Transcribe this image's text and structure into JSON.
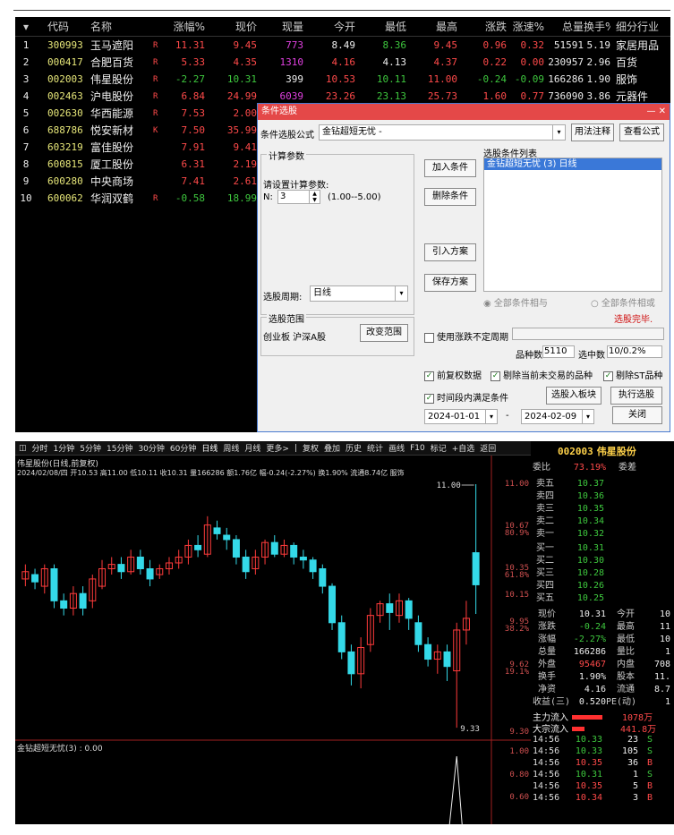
{
  "table": {
    "headers": [
      "代码",
      "名称",
      "",
      "涨幅%",
      "现价",
      "现量",
      "今开",
      "最低",
      "最高",
      "涨跌",
      "涨速%",
      "总量",
      "换手%",
      "细分行业"
    ],
    "rows": [
      {
        "idx": "1",
        "code": "300993",
        "name": "玉马遮阳",
        "flag": "R",
        "chg": "11.31",
        "price": "9.45",
        "vol": "773",
        "open": "8.49",
        "low": "8.36",
        "high": "9.45",
        "diff": "0.96",
        "speed": "0.32",
        "total": "51591",
        "turn": "5.19",
        "ind": "家居用品"
      },
      {
        "idx": "2",
        "code": "000417",
        "name": "合肥百货",
        "flag": "R",
        "chg": "5.33",
        "price": "4.35",
        "vol": "1310",
        "open": "4.16",
        "low": "4.13",
        "high": "4.37",
        "diff": "0.22",
        "speed": "0.00",
        "total": "230957",
        "turn": "2.96",
        "ind": "百货"
      },
      {
        "idx": "3",
        "code": "002003",
        "name": "伟星股份",
        "flag": "R",
        "chg": "-2.27",
        "price": "10.31",
        "vol": "399",
        "open": "10.53",
        "low": "10.11",
        "high": "11.00",
        "diff": "-0.24",
        "speed": "-0.09",
        "total": "166286",
        "turn": "1.90",
        "ind": "服饰"
      },
      {
        "idx": "4",
        "code": "002463",
        "name": "沪电股份",
        "flag": "R",
        "chg": "6.84",
        "price": "24.99",
        "vol": "6039",
        "open": "23.26",
        "low": "23.13",
        "high": "25.73",
        "diff": "1.60",
        "speed": "0.77",
        "total": "736090",
        "turn": "3.86",
        "ind": "元器件"
      },
      {
        "idx": "5",
        "code": "002630",
        "name": "华西能源",
        "flag": "R",
        "chg": "7.53",
        "price": "2.00"
      },
      {
        "idx": "6",
        "code": "688786",
        "name": "悦安新材",
        "flag": "K",
        "chg": "7.50",
        "price": "35.99"
      },
      {
        "idx": "7",
        "code": "603219",
        "name": "富佳股份",
        "flag": "",
        "chg": "7.91",
        "price": "9.41"
      },
      {
        "idx": "8",
        "code": "600815",
        "name": "厦工股份",
        "flag": "",
        "chg": "6.31",
        "price": "2.19"
      },
      {
        "idx": "9",
        "code": "600280",
        "name": "中央商场",
        "flag": "",
        "chg": "7.41",
        "price": "2.61"
      },
      {
        "idx": "10",
        "code": "600062",
        "name": "华润双鹤",
        "flag": "R",
        "chg": "-0.58",
        "price": "18.99"
      }
    ]
  },
  "dialog": {
    "title": "条件选股",
    "formula_label": "条件选股公式",
    "formula_value": "金钻超短无忧 -",
    "usage_btn": "用法注释",
    "view_btn": "查看公式",
    "calc_group": "计算参数",
    "calc_hint": "请设置计算参数:",
    "n_label": "N:",
    "n_value": "3",
    "n_range": "(1.00--5.00)",
    "add_btn": "加入条件",
    "del_btn": "删除条件",
    "import_btn": "引入方案",
    "save_btn": "保存方案",
    "list_title": "选股条件列表",
    "list_item": "金钻超短无忧 (3) 日线",
    "and_label": "全部条件相与",
    "or_label": "全部条件相或",
    "done": "选股完毕.",
    "period_label": "选股周期:",
    "period_value": "日线",
    "range_group": "选股范围",
    "range_value": "创业板 沪深A股",
    "range_btn": "改变范围",
    "use_period": "使用涨跌不定周期",
    "count_label": "品种数",
    "count_value": "5110",
    "sel_label": "选中数",
    "sel_value": "10/0.2%",
    "opt1": "前复权数据",
    "opt2": "剔除当前未交易的品种",
    "opt3": "剔除ST品种",
    "opt4": "时间段内满足条件",
    "to_block": "选股入板块",
    "exec": "执行选股",
    "close": "关闭",
    "date_from": "2024-01-01",
    "date_to": "2024-02-09"
  },
  "chart": {
    "toolbar": [
      "分时",
      "1分钟",
      "5分钟",
      "15分钟",
      "30分钟",
      "60分钟",
      "日线",
      "周线",
      "月线",
      "更多>"
    ],
    "toolbar2": [
      "复权",
      "叠加",
      "历史",
      "统计",
      "画线",
      "F10",
      "标记",
      "+自选",
      "返回"
    ],
    "title": "伟星股份(日线,前复权)",
    "info": "2024/02/08/四 开10.53 高11.00 低10.11 收10.31 量166286 额1.76亿 幅-0.24(-2.27%) 换1.90% 流通8.74亿 服饰",
    "hi_label": "11.00",
    "lo_label": "9.33",
    "yticks": [
      "11.00",
      "10.67",
      "80.9%",
      "10.35",
      "61.8%",
      "10.15",
      "9.95",
      "38.2%",
      "9.62",
      "19.1%",
      "9.30"
    ],
    "indicator": "金钻超短无忧(3) : 0.00",
    "ind_ticks": [
      "1.00",
      "0.80",
      "0.60",
      "0.40",
      "0.20"
    ],
    "candles": [
      [
        10.35,
        10.4,
        10.3,
        10.45
      ],
      [
        10.38,
        10.33,
        10.28,
        10.42
      ],
      [
        10.3,
        10.42,
        10.25,
        10.45
      ],
      [
        10.42,
        10.2,
        10.15,
        10.45
      ],
      [
        10.2,
        10.15,
        10.1,
        10.25
      ],
      [
        10.15,
        10.25,
        10.1,
        10.3
      ],
      [
        10.25,
        10.15,
        10.1,
        10.3
      ],
      [
        10.2,
        10.35,
        10.15,
        10.38
      ],
      [
        10.3,
        10.42,
        10.28,
        10.48
      ],
      [
        10.42,
        10.45,
        10.38,
        10.5
      ],
      [
        10.45,
        10.4,
        10.35,
        10.5
      ],
      [
        10.4,
        10.5,
        10.38,
        10.55
      ],
      [
        10.5,
        10.42,
        10.38,
        10.55
      ],
      [
        10.42,
        10.35,
        10.3,
        10.48
      ],
      [
        10.38,
        10.42,
        10.35,
        10.45
      ],
      [
        10.42,
        10.46,
        10.38,
        10.5
      ],
      [
        10.46,
        10.5,
        10.42,
        10.55
      ],
      [
        10.5,
        10.58,
        10.45,
        10.62
      ],
      [
        10.58,
        10.55,
        10.5,
        10.65
      ],
      [
        10.52,
        10.72,
        10.5,
        10.78
      ],
      [
        10.7,
        10.66,
        10.62,
        10.75
      ],
      [
        10.65,
        10.62,
        10.55,
        10.7
      ],
      [
        10.62,
        10.5,
        10.45,
        10.65
      ],
      [
        10.5,
        10.4,
        10.35,
        10.55
      ],
      [
        10.42,
        10.5,
        10.38,
        10.55
      ],
      [
        10.5,
        10.6,
        10.45,
        10.62
      ],
      [
        10.6,
        10.52,
        10.5,
        10.65
      ],
      [
        10.52,
        10.58,
        10.5,
        10.62
      ],
      [
        10.58,
        10.5,
        10.45,
        10.6
      ],
      [
        10.5,
        10.48,
        10.42,
        10.55
      ],
      [
        10.48,
        10.4,
        10.35,
        10.5
      ],
      [
        10.42,
        10.3,
        10.25,
        10.45
      ],
      [
        10.3,
        10.05,
        10.0,
        10.32
      ],
      [
        10.05,
        9.85,
        9.8,
        10.1
      ],
      [
        9.85,
        9.7,
        9.62,
        9.9
      ],
      [
        9.7,
        9.88,
        9.6,
        9.95
      ],
      [
        9.9,
        10.1,
        9.85,
        10.15
      ],
      [
        10.1,
        10.18,
        10.05,
        10.2
      ],
      [
        10.18,
        10.12,
        10.0,
        10.25
      ],
      [
        10.1,
        10.2,
        10.05,
        10.25
      ],
      [
        10.2,
        10.08,
        10.0,
        10.22
      ],
      [
        10.05,
        9.9,
        9.85,
        10.1
      ],
      [
        9.9,
        9.8,
        9.75,
        9.95
      ],
      [
        9.8,
        9.85,
        9.7,
        9.9
      ],
      [
        9.85,
        9.75,
        9.65,
        9.9
      ],
      [
        9.72,
        10.0,
        9.33,
        10.05
      ],
      [
        10.0,
        10.08,
        9.9,
        10.2
      ],
      [
        10.53,
        10.31,
        10.11,
        11.0
      ]
    ],
    "ind_spike_index": 45
  },
  "panel": {
    "code": "002003",
    "name": "伟星股份",
    "wb_label": "委比",
    "wb": "73.19%",
    "wc_label": "委差",
    "asks": [
      [
        "卖五",
        "10.37"
      ],
      [
        "卖四",
        "10.36"
      ],
      [
        "卖三",
        "10.35"
      ],
      [
        "卖二",
        "10.34"
      ],
      [
        "卖一",
        "10.32"
      ]
    ],
    "bids": [
      [
        "买一",
        "10.31"
      ],
      [
        "买二",
        "10.30"
      ],
      [
        "买三",
        "10.28"
      ],
      [
        "买四",
        "10.26"
      ],
      [
        "买五",
        "10.25"
      ]
    ],
    "stats": [
      [
        "现价",
        "10.31",
        "今开",
        "10"
      ],
      [
        "涨跌",
        "-0.24",
        "最高",
        "11"
      ],
      [
        "涨幅",
        "-2.27%",
        "最低",
        "10"
      ],
      [
        "总量",
        "166286",
        "量比",
        "1"
      ],
      [
        "外盘",
        "95467",
        "内盘",
        "708"
      ],
      [
        "换手",
        "1.90%",
        "股本",
        "11."
      ],
      [
        "净资",
        "4.16",
        "流通",
        "8.7"
      ],
      [
        "收益(三)",
        "0.520",
        "PE(动)",
        "1"
      ]
    ],
    "flows": [
      [
        "主力流入",
        "1078万"
      ],
      [
        "大宗流入",
        "441.8万"
      ]
    ],
    "ticks": [
      [
        "14:56",
        "10.33",
        "23",
        "S"
      ],
      [
        "14:56",
        "10.33",
        "105",
        "S"
      ],
      [
        "14:56",
        "10.35",
        "36",
        "B"
      ],
      [
        "14:56",
        "10.31",
        "1",
        "S"
      ],
      [
        "14:56",
        "10.35",
        "5",
        "B"
      ],
      [
        "14:56",
        "10.34",
        "3",
        "B"
      ]
    ]
  }
}
